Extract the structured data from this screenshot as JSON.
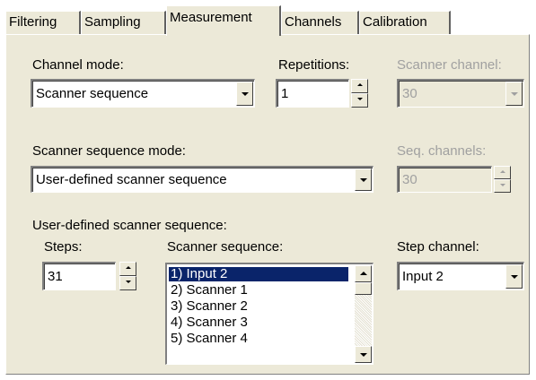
{
  "tabs": [
    "Filtering",
    "Sampling",
    "Measurement",
    "Channels",
    "Calibration"
  ],
  "active_tab": "Measurement",
  "channel_mode": {
    "label": "Channel mode:",
    "value": "Scanner sequence"
  },
  "repetitions": {
    "label": "Repetitions:",
    "value": "1"
  },
  "scanner_channel": {
    "label": "Scanner channel:",
    "value": "30",
    "enabled": false
  },
  "seq_mode": {
    "label": "Scanner sequence mode:",
    "value": "User-defined scanner sequence"
  },
  "seq_channels": {
    "label": "Seq. channels:",
    "value": "30",
    "enabled": false
  },
  "user_seq": {
    "label": "User-defined scanner sequence:"
  },
  "steps": {
    "label": "Steps:",
    "value": "31"
  },
  "scanner_sequence": {
    "label": "Scanner sequence:",
    "items": [
      "1) Input 2",
      "2) Scanner 1",
      "3) Scanner 2",
      "4) Scanner 3",
      "5) Scanner 4"
    ],
    "selected_index": 0
  },
  "step_channel": {
    "label": "Step channel:",
    "value": "Input 2"
  },
  "colors": {
    "face": "#ece9d8",
    "selection": "#0a246a",
    "disabled_text": "#a0a0a0"
  }
}
